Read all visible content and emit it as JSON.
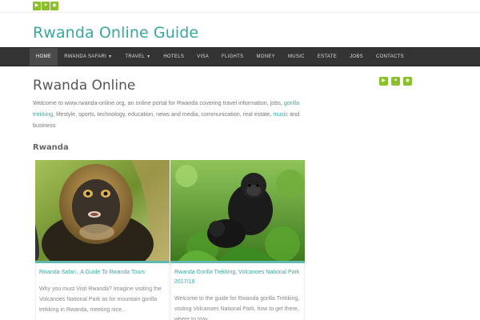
{
  "topbar": {
    "icons": [
      {
        "name": "youtube-icon",
        "glyph": "▶"
      },
      {
        "name": "twitter-icon",
        "glyph": "✦"
      },
      {
        "name": "rss-icon",
        "glyph": "◉"
      }
    ]
  },
  "site": {
    "title": "Rwanda Online Guide"
  },
  "nav": {
    "items": [
      {
        "label": "HOME",
        "active": true
      },
      {
        "label": "RWANDA SAFARI",
        "dropdown": true
      },
      {
        "label": "TRAVEL",
        "dropdown": true
      },
      {
        "label": "HOTELS"
      },
      {
        "label": "VISA"
      },
      {
        "label": "FLIGHTS"
      },
      {
        "label": "MONEY"
      },
      {
        "label": "MUSIC"
      },
      {
        "label": "ESTATE"
      },
      {
        "label": "JOBS"
      },
      {
        "label": "CONTACTS"
      }
    ]
  },
  "main": {
    "title": "Rwanda Online",
    "intro_before": "Welcome to www.rwanda-online.org, an online portal for Rwanda covering travel information, jobs, ",
    "intro_link1": "gorilla trekking",
    "intro_middle": ", lifestyle, sports, technology, education, news and media, communication, real estate, ",
    "intro_link2": "music",
    "intro_after": " and business",
    "section_title": "Rwanda",
    "cards": [
      {
        "title": "Rwanda Safari , A Guide To Rwanda Tours",
        "excerpt": "Why you must Visit Rwanda? Imagine visiting the Volcanoes National Park as for mountain gorilla trekking in Rwanda,  meeting nice..."
      },
      {
        "title": "Rwanda Gorilla Trekking, Volcanoes National Park 2017/18",
        "excerpt": "Welcome to the guide for Rwanda gorilla Trekking, visiting Volcanoes National Park, how to get there, where to stay..."
      }
    ]
  },
  "sidebar": {
    "icons": [
      {
        "name": "youtube-icon",
        "glyph": "▶"
      },
      {
        "name": "twitter-icon",
        "glyph": "✦"
      },
      {
        "name": "rss-icon",
        "glyph": "◉"
      }
    ]
  },
  "colors": {
    "accent": "#3aa7a0",
    "social": "#8bbf2b",
    "nav_bg": "#333333"
  }
}
